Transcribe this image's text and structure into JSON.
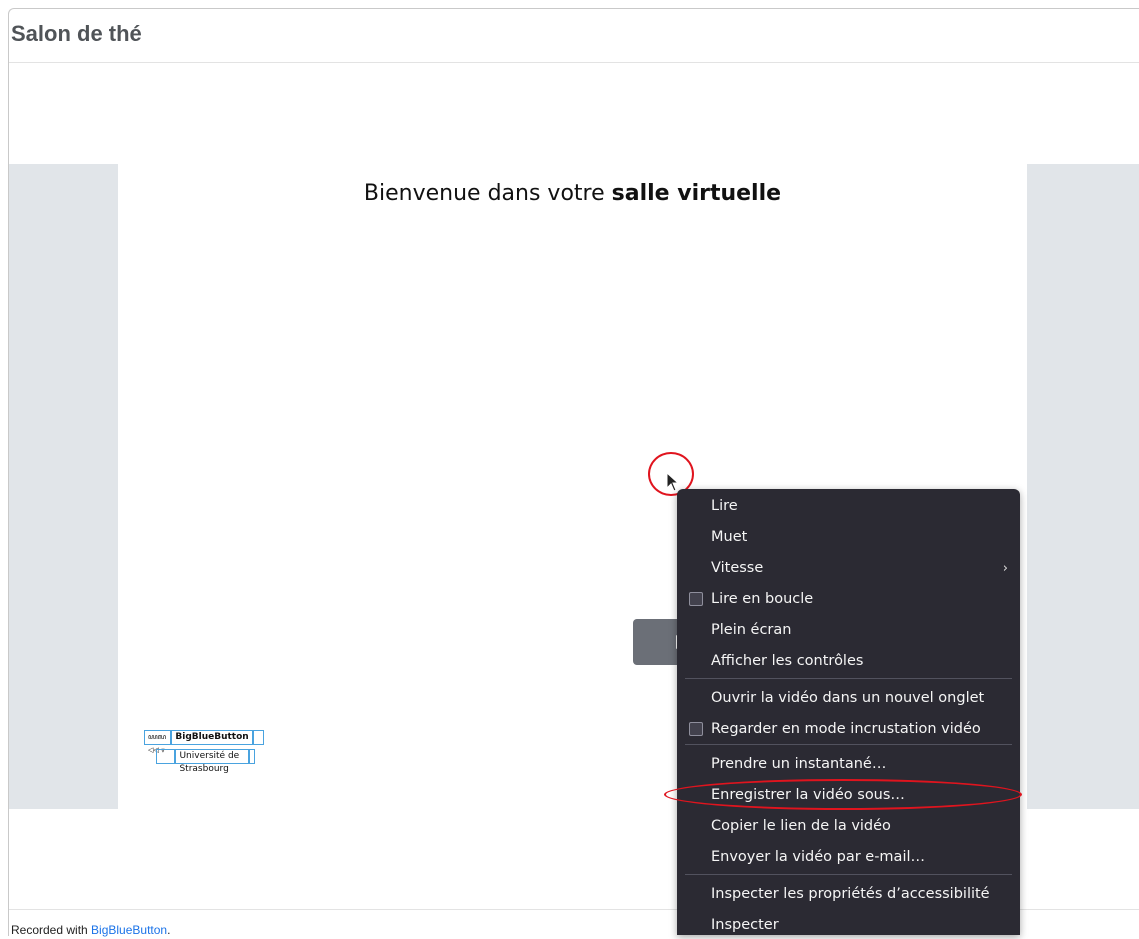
{
  "page": {
    "title": "Salon de thé",
    "footer_prefix": "Recorded with ",
    "footer_link": "BigBlueButton",
    "footer_suffix": "."
  },
  "slide": {
    "heading_normal": "Bienvenue dans votre ",
    "heading_bold": "salle virtuelle",
    "logo": {
      "icons": "ꦪꦭ ◁◁ ⩔",
      "brand": "BigBlueButton",
      "institution": "Université de Strasbourg"
    }
  },
  "player": {
    "play_icon": "play-icon"
  },
  "context_menu": {
    "items": [
      {
        "label": "Lire",
        "checkbox": false,
        "submenu": false
      },
      {
        "label": "Muet",
        "checkbox": false,
        "submenu": false
      },
      {
        "label": "Vitesse",
        "checkbox": false,
        "submenu": true
      },
      {
        "label": "Lire en boucle",
        "checkbox": true,
        "checked": false,
        "submenu": false
      },
      {
        "label": "Plein écran",
        "checkbox": false,
        "submenu": false
      },
      {
        "label": "Afficher les contrôles",
        "checkbox": false,
        "submenu": false
      },
      {
        "label": "Ouvrir la vidéo dans un nouvel onglet",
        "checkbox": false,
        "submenu": false
      },
      {
        "label": "Regarder en mode incrustation vidéo",
        "checkbox": true,
        "checked": false,
        "submenu": false
      },
      {
        "label": "Prendre un instantané…",
        "checkbox": false,
        "submenu": false
      },
      {
        "label": "Enregistrer la vidéo sous…",
        "checkbox": false,
        "submenu": false,
        "highlighted_annotation": true
      },
      {
        "label": "Copier le lien de la vidéo",
        "checkbox": false,
        "submenu": false
      },
      {
        "label": "Envoyer la vidéo par e-mail…",
        "checkbox": false,
        "submenu": false
      },
      {
        "label": "Inspecter les propriétés d’accessibilité",
        "checkbox": false,
        "submenu": false
      },
      {
        "label": "Inspecter",
        "checkbox": false,
        "submenu": false
      }
    ],
    "submenu_arrow": "›"
  },
  "colors": {
    "menu_bg": "#2b2a33",
    "annotation_red": "#e0141e",
    "link_blue": "#1b73e8",
    "player_bg": "#e1e5e9"
  }
}
